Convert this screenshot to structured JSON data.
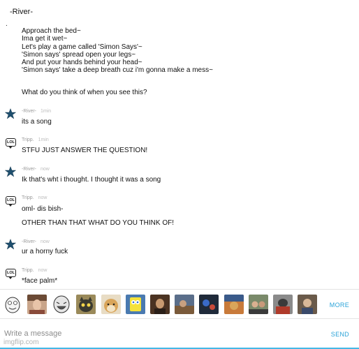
{
  "post": {
    "author": "-River-",
    "dot": ".",
    "lines": [
      "Approach the bed~",
      "Ima get it wet~",
      "Let's play a game called 'Simon Says'~",
      "'Simon says' spread open your legs~",
      "And put your hands behind your head~",
      "'Simon says' take a deep breath cuz i'm gonna make a mess~"
    ],
    "question": "What do you think of when you see this?"
  },
  "messages": [
    {
      "avatar": "star-icon",
      "author": "-River-",
      "time": "1min",
      "lines": [
        "its a song"
      ]
    },
    {
      "avatar": "lol-icon",
      "author": "Tripp.",
      "time": "1min",
      "lines": [
        "STFU JUST ANSWER THE QUESTION!"
      ]
    },
    {
      "avatar": "star-icon",
      "author": "-River-",
      "time": "now",
      "lines": [
        "Ik that's wht i thought. I thought it was a song"
      ]
    },
    {
      "avatar": "lol-icon",
      "author": "Tripp.",
      "time": "now",
      "lines": [
        "oml- dis bish-",
        "OTHER THAN THAT WHAT DO YOU THINK OF!"
      ]
    },
    {
      "avatar": "star-icon",
      "author": "-River-",
      "time": "now",
      "lines": [
        "ur a horny fuck"
      ]
    },
    {
      "avatar": "lol-icon",
      "author": "Tripp.",
      "time": "now",
      "lines": [
        "*face palm*"
      ]
    }
  ],
  "stickers": {
    "items": [
      "rage-face-sticker",
      "woman-sticker",
      "lol-face-sticker",
      "cat-sticker",
      "doge-sticker",
      "sponge-sticker",
      "photo-sticker-1",
      "photo-sticker-2",
      "photo-sticker-3",
      "photo-sticker-4",
      "photo-sticker-5",
      "photo-sticker-6",
      "photo-sticker-7"
    ],
    "more_label": "MORE"
  },
  "composer": {
    "placeholder": "Write a message",
    "send_label": "SEND"
  },
  "watermark": "imgflip.com",
  "colors": {
    "accent": "#2aa3d8",
    "star": "#1f4f6e"
  }
}
